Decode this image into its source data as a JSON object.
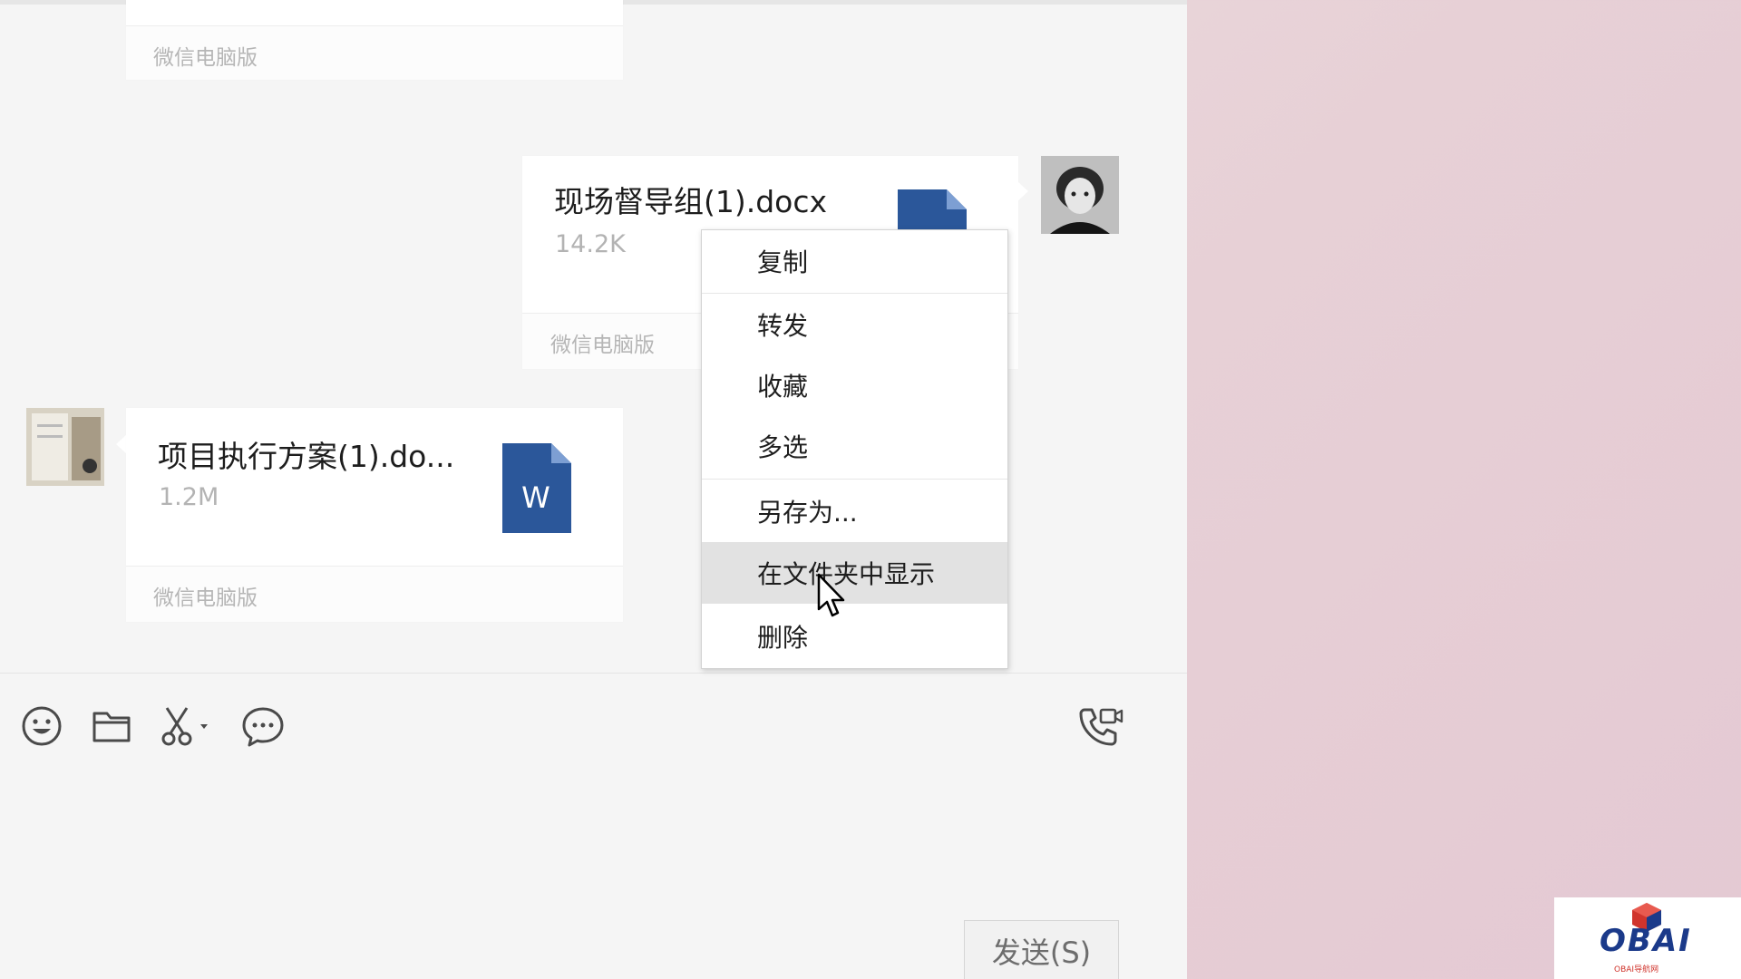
{
  "messages": [
    {
      "source": "微信电脑版"
    },
    {
      "file_name": "现场督导组(1).docx",
      "file_size": "14.2K",
      "source": "微信电脑版"
    },
    {
      "file_name": "项目执行方案(1).do...",
      "file_size": "1.2M",
      "source": "微信电脑版",
      "file_icon_letter": "W"
    }
  ],
  "context_menu": {
    "items": [
      {
        "label": "复制"
      },
      {
        "label": "转发"
      },
      {
        "label": "收藏"
      },
      {
        "label": "多选"
      },
      {
        "label": "另存为..."
      },
      {
        "label": "在文件夹中显示"
      },
      {
        "label": "删除"
      }
    ],
    "hovered": "在文件夹中显示"
  },
  "toolbar": {
    "icons": [
      "emoji-icon",
      "folder-icon",
      "scissors-icon",
      "chat-bubble-icon",
      "video-call-icon"
    ],
    "send_label": "发送(S)"
  },
  "watermark": {
    "logo_text": "OBAI",
    "sub_text": "OBAI导航网"
  },
  "colors": {
    "word_blue": "#2b579a",
    "chat_bg": "#f5f5f5",
    "desktop_bg": "#e7d0d6"
  }
}
